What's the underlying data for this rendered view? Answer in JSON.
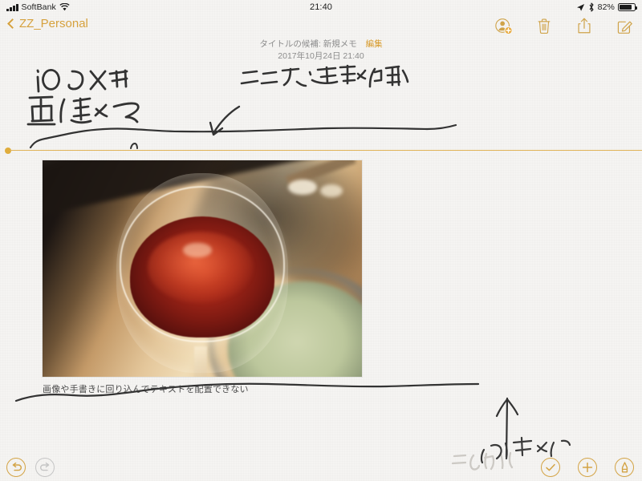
{
  "status_bar": {
    "signal_icon": "cellular-bars-icon",
    "carrier": "SoftBank",
    "wifi_icon": "wifi-icon",
    "time": "21:40",
    "location_icon": "location-arrow-icon",
    "bluetooth_icon": "bluetooth-icon",
    "battery_percent": "82%",
    "battery_icon": "battery-icon",
    "battery_level": 82
  },
  "nav_bar": {
    "back_icon": "chevron-left-icon",
    "back_label": "ZZ_Personal",
    "actions": [
      {
        "name": "add-person-icon",
        "label": "共有相手を追加"
      },
      {
        "name": "trash-icon",
        "label": "削除"
      },
      {
        "name": "share-icon",
        "label": "共有"
      },
      {
        "name": "compose-icon",
        "label": "新規メモ"
      }
    ]
  },
  "note": {
    "title_candidate_label": "タイトルの候補:",
    "title_candidate_value": "新規メモ",
    "edit_label": "編集",
    "timestamp": "2017年10月24日 21:40",
    "caption": "画像や手書きに回り込んでテキストを配置できない",
    "divider_name": "handwriting-area-divider",
    "photo_alt": "赤ワインの入ったグラスの写真"
  },
  "handwriting": [
    {
      "name": "ink-text-ios-memo",
      "text": "iOSメモ"
    },
    {
      "name": "ink-text-gazou",
      "text": "画像"
    },
    {
      "name": "ink-text-here-handwriting-area",
      "text": "ここまで手書き領域"
    },
    {
      "name": "ink-arrow-down-left",
      "text": ""
    },
    {
      "name": "ink-line-top",
      "text": ""
    },
    {
      "name": "ink-line-bottom",
      "text": ""
    },
    {
      "name": "ink-arrow-up",
      "text": ""
    },
    {
      "name": "ink-text-bottom-faint",
      "text": "このへんに書けない"
    }
  ],
  "bottom_bar": {
    "undo_icon": "undo-icon",
    "undo_enabled": true,
    "redo_icon": "redo-icon",
    "redo_enabled": false,
    "done_icon": "checkmark-circle-icon",
    "add_icon": "plus-circle-icon",
    "marker_icon": "marker-pen-icon"
  },
  "colors": {
    "accent": "#d6a13d",
    "divider": "#e0b357",
    "background": "#f5f4f2",
    "muted_text": "#8c8c8c",
    "ink": "#333333"
  }
}
